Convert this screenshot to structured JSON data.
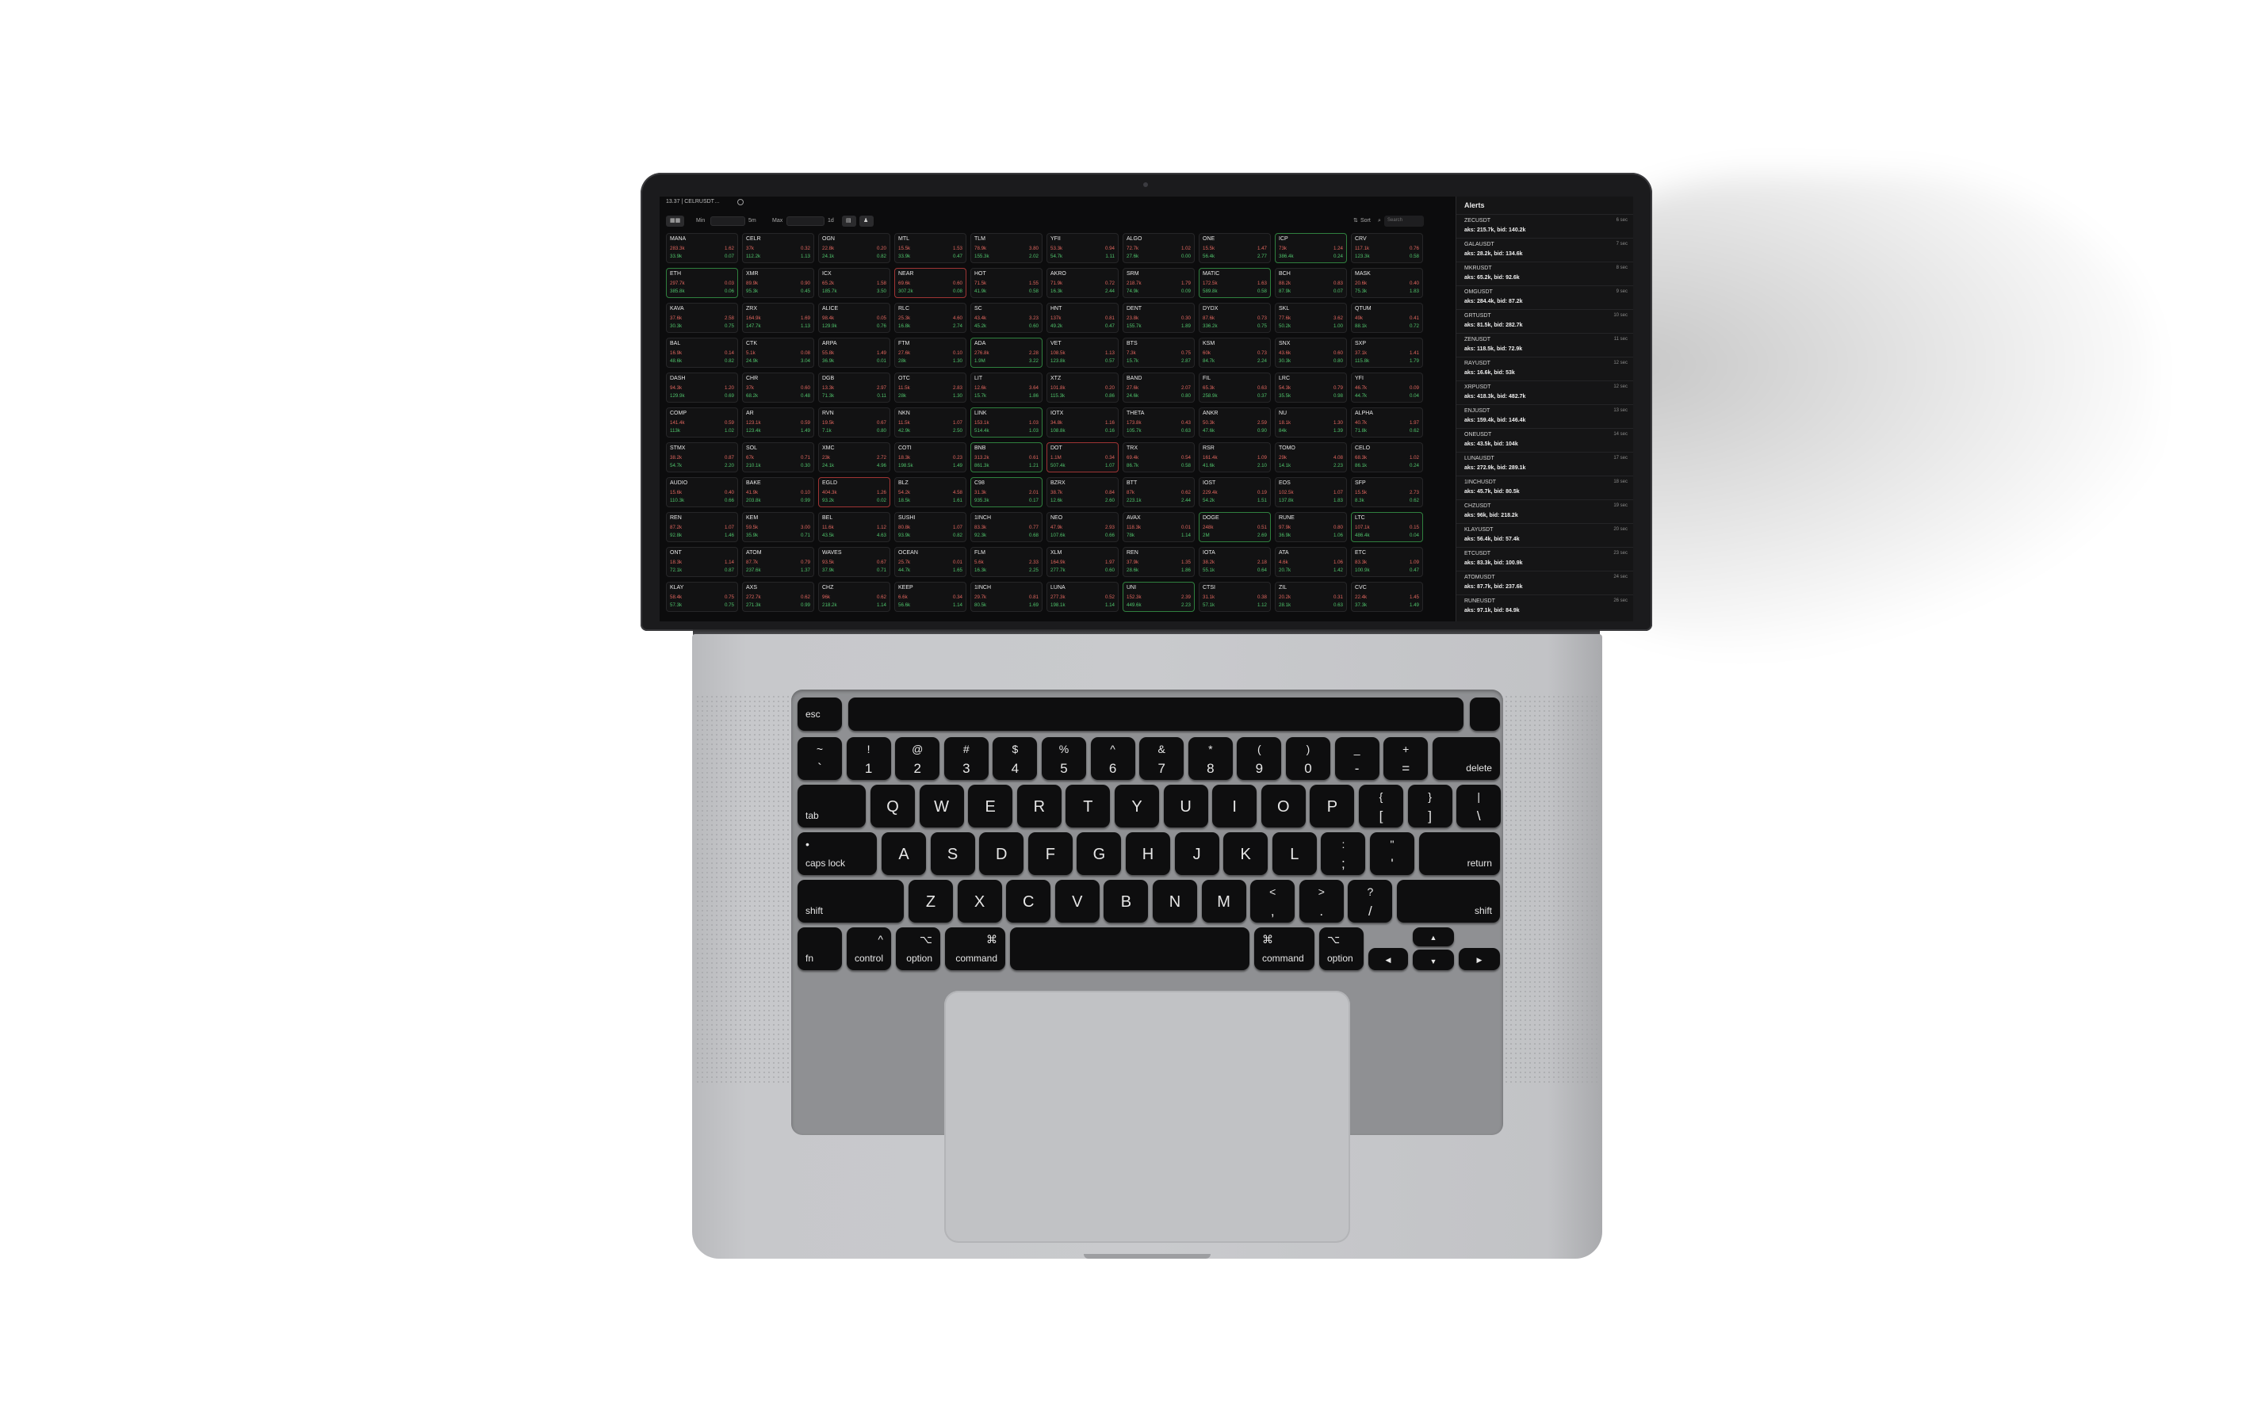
{
  "window": {
    "title": "13.37 | CELRUSDT…"
  },
  "toolbar": {
    "grid_label": "▦▦",
    "min_label": "Min",
    "min_unit": "5m",
    "max_label": "Max",
    "max_unit": "1d",
    "sort_label": "Sort",
    "search_placeholder": "Search"
  },
  "tiles": [
    [
      "MANA",
      "283.3k",
      "1.62",
      "33.9k",
      "0.07",
      ""
    ],
    [
      "CELR",
      "37k",
      "0.32",
      "112.2k",
      "1.13",
      ""
    ],
    [
      "OGN",
      "22.8k",
      "0.20",
      "24.1k",
      "0.82",
      ""
    ],
    [
      "MTL",
      "15.5k",
      "1.53",
      "33.9k",
      "0.47",
      ""
    ],
    [
      "TLM",
      "78.9k",
      "3.80",
      "155.3k",
      "2.02",
      ""
    ],
    [
      "YFII",
      "53.3k",
      "0.94",
      "54.7k",
      "1.11",
      ""
    ],
    [
      "ALGO",
      "72.7k",
      "1.02",
      "27.6k",
      "0.00",
      ""
    ],
    [
      "ONE",
      "15.5k",
      "1.47",
      "56.4k",
      "2.77",
      ""
    ],
    [
      "ICP",
      "73k",
      "1.24",
      "386.4k",
      "0.24",
      "up"
    ],
    [
      "CRV",
      "117.1k",
      "0.76",
      "123.3k",
      "0.58",
      ""
    ],
    [
      "ETH",
      "297.7k",
      "0.03",
      "385.8k",
      "0.06",
      "up"
    ],
    [
      "XMR",
      "89.9k",
      "0.90",
      "95.3k",
      "0.45",
      ""
    ],
    [
      "ICX",
      "65.2k",
      "1.58",
      "185.7k",
      "3.50",
      ""
    ],
    [
      "NEAR",
      "69.6k",
      "0.60",
      "307.2k",
      "0.08",
      "down"
    ],
    [
      "HOT",
      "71.5k",
      "1.55",
      "41.9k",
      "0.58",
      ""
    ],
    [
      "AKRO",
      "71.9k",
      "0.72",
      "16.3k",
      "2.44",
      ""
    ],
    [
      "SRM",
      "218.7k",
      "1.79",
      "74.9k",
      "0.09",
      ""
    ],
    [
      "MATIC",
      "172.5k",
      "1.63",
      "589.8k",
      "0.58",
      "up"
    ],
    [
      "BCH",
      "88.2k",
      "0.83",
      "87.9k",
      "0.07",
      ""
    ],
    [
      "MASK",
      "20.6k",
      "0.40",
      "75.3k",
      "1.83",
      ""
    ],
    [
      "KAVA",
      "37.6k",
      "2.58",
      "30.3k",
      "0.75",
      ""
    ],
    [
      "ZRX",
      "164.9k",
      "1.69",
      "147.7k",
      "1.13",
      ""
    ],
    [
      "ALICE",
      "98.4k",
      "0.05",
      "129.9k",
      "0.76",
      ""
    ],
    [
      "RLC",
      "25.3k",
      "4.60",
      "16.8k",
      "2.74",
      ""
    ],
    [
      "SC",
      "43.4k",
      "3.23",
      "45.2k",
      "0.60",
      ""
    ],
    [
      "HNT",
      "137k",
      "0.81",
      "49.2k",
      "0.47",
      ""
    ],
    [
      "DENT",
      "23.8k",
      "0.30",
      "155.7k",
      "1.89",
      ""
    ],
    [
      "DYDX",
      "87.6k",
      "0.73",
      "336.2k",
      "0.75",
      ""
    ],
    [
      "SKL",
      "77.6k",
      "3.62",
      "50.2k",
      "1.00",
      ""
    ],
    [
      "QTUM",
      "49k",
      "0.41",
      "88.1k",
      "0.72",
      ""
    ],
    [
      "BAL",
      "16.9k",
      "0.14",
      "48.6k",
      "0.82",
      ""
    ],
    [
      "CTK",
      "5.1k",
      "0.08",
      "24.9k",
      "3.04",
      ""
    ],
    [
      "ARPA",
      "55.8k",
      "1.49",
      "36.9k",
      "0.01",
      ""
    ],
    [
      "FTM",
      "27.6k",
      "0.10",
      "28k",
      "1.30",
      ""
    ],
    [
      "ADA",
      "276.8k",
      "2.28",
      "1.9M",
      "3.22",
      "up"
    ],
    [
      "VET",
      "108.5k",
      "1.13",
      "123.8k",
      "0.57",
      ""
    ],
    [
      "BTS",
      "7.3k",
      "0.75",
      "15.7k",
      "2.87",
      ""
    ],
    [
      "KSM",
      "60k",
      "0.73",
      "84.7k",
      "2.24",
      ""
    ],
    [
      "SNX",
      "43.6k",
      "0.60",
      "30.3k",
      "0.80",
      ""
    ],
    [
      "SXP",
      "37.1k",
      "1.41",
      "115.8k",
      "1.79",
      ""
    ],
    [
      "DASH",
      "94.3k",
      "1.20",
      "129.9k",
      "0.69",
      ""
    ],
    [
      "CHR",
      "37k",
      "0.60",
      "68.2k",
      "0.48",
      ""
    ],
    [
      "DGB",
      "13.3k",
      "2.97",
      "71.3k",
      "0.11",
      ""
    ],
    [
      "OTC",
      "11.5k",
      "2.83",
      "28k",
      "1.30",
      ""
    ],
    [
      "LIT",
      "12.6k",
      "3.64",
      "15.7k",
      "1.86",
      ""
    ],
    [
      "XTZ",
      "101.8k",
      "0.20",
      "115.3k",
      "0.86",
      ""
    ],
    [
      "BAND",
      "27.6k",
      "2.07",
      "24.6k",
      "0.80",
      ""
    ],
    [
      "FIL",
      "65.3k",
      "0.63",
      "258.9k",
      "0.37",
      ""
    ],
    [
      "LRC",
      "54.3k",
      "0.79",
      "35.5k",
      "0.98",
      ""
    ],
    [
      "YFI",
      "46.7k",
      "0.09",
      "44.7k",
      "0.04",
      ""
    ],
    [
      "COMP",
      "141.4k",
      "0.59",
      "113k",
      "1.02",
      ""
    ],
    [
      "AR",
      "123.1k",
      "0.59",
      "123.4k",
      "1.49",
      ""
    ],
    [
      "RVN",
      "19.5k",
      "0.67",
      "7.1k",
      "0.80",
      ""
    ],
    [
      "NKN",
      "11.5k",
      "1.07",
      "42.9k",
      "2.50",
      ""
    ],
    [
      "LINK",
      "153.1k",
      "1.03",
      "514.4k",
      "1.03",
      "up"
    ],
    [
      "IOTX",
      "34.8k",
      "1.16",
      "108.8k",
      "0.16",
      ""
    ],
    [
      "THETA",
      "173.8k",
      "0.43",
      "105.7k",
      "0.63",
      ""
    ],
    [
      "ANKR",
      "50.3k",
      "2.59",
      "47.6k",
      "0.90",
      ""
    ],
    [
      "NU",
      "18.1k",
      "1.30",
      "84k",
      "1.39",
      ""
    ],
    [
      "ALPHA",
      "40.7k",
      "1.97",
      "71.8k",
      "0.62",
      ""
    ],
    [
      "STMX",
      "38.2k",
      "0.87",
      "54.7k",
      "2.20",
      ""
    ],
    [
      "SOL",
      "67k",
      "0.71",
      "210.1k",
      "0.30",
      ""
    ],
    [
      "XMC",
      "23k",
      "2.72",
      "24.1k",
      "4.96",
      ""
    ],
    [
      "COTI",
      "18.3k",
      "0.23",
      "198.5k",
      "1.49",
      ""
    ],
    [
      "BNB",
      "313.2k",
      "0.61",
      "861.3k",
      "1.21",
      "up"
    ],
    [
      "DOT",
      "1.1M",
      "0.34",
      "507.4k",
      "1.07",
      "down"
    ],
    [
      "TRX",
      "69.4k",
      "0.54",
      "86.7k",
      "0.58",
      ""
    ],
    [
      "RSR",
      "161.4k",
      "1.09",
      "41.6k",
      "2.10",
      ""
    ],
    [
      "TOMO",
      "29k",
      "4.08",
      "14.1k",
      "2.23",
      ""
    ],
    [
      "CELO",
      "68.3k",
      "1.02",
      "86.1k",
      "0.24",
      ""
    ],
    [
      "AUDIO",
      "15.6k",
      "0.40",
      "110.3k",
      "0.66",
      ""
    ],
    [
      "BAKE",
      "41.9k",
      "0.10",
      "203.8k",
      "0.99",
      ""
    ],
    [
      "EGLD",
      "404.3k",
      "1.26",
      "93.2k",
      "0.02",
      "down"
    ],
    [
      "BLZ",
      "54.2k",
      "4.58",
      "18.5k",
      "1.61",
      ""
    ],
    [
      "C98",
      "31.3k",
      "2.01",
      "935.3k",
      "0.17",
      "up"
    ],
    [
      "BZRX",
      "38.7k",
      "0.84",
      "12.6k",
      "2.60",
      ""
    ],
    [
      "BTT",
      "87k",
      "0.62",
      "223.1k",
      "2.44",
      ""
    ],
    [
      "IOST",
      "229.4k",
      "0.19",
      "54.2k",
      "1.51",
      ""
    ],
    [
      "EOS",
      "102.5k",
      "1.07",
      "137.8k",
      "1.83",
      ""
    ],
    [
      "SFP",
      "15.5k",
      "2.73",
      "8.3k",
      "0.62",
      ""
    ],
    [
      "REN",
      "87.2k",
      "1.07",
      "92.8k",
      "1.46",
      ""
    ],
    [
      "KEM",
      "59.5k",
      "3.00",
      "35.9k",
      "0.71",
      ""
    ],
    [
      "BEL",
      "11.6k",
      "1.12",
      "43.5k",
      "4.63",
      ""
    ],
    [
      "SUSHI",
      "80.8k",
      "1.07",
      "93.9k",
      "0.82",
      ""
    ],
    [
      "1INCH",
      "83.3k",
      "0.77",
      "92.3k",
      "0.68",
      ""
    ],
    [
      "NEO",
      "47.9k",
      "2.93",
      "107.6k",
      "0.66",
      ""
    ],
    [
      "AVAX",
      "118.3k",
      "0.01",
      "78k",
      "1.14",
      ""
    ],
    [
      "DOGE",
      "248k",
      "0.51",
      "2M",
      "2.69",
      "up"
    ],
    [
      "RUNE",
      "97.9k",
      "0.80",
      "36.9k",
      "1.06",
      ""
    ],
    [
      "LTC",
      "107.1k",
      "0.15",
      "486.4k",
      "0.04",
      "up"
    ],
    [
      "ONT",
      "18.3k",
      "1.14",
      "72.1k",
      "0.87",
      ""
    ],
    [
      "ATOM",
      "87.7k",
      "0.79",
      "237.6k",
      "1.37",
      ""
    ],
    [
      "WAVES",
      "93.5k",
      "0.67",
      "37.9k",
      "0.71",
      ""
    ],
    [
      "OCEAN",
      "25.7k",
      "0.01",
      "44.7k",
      "1.65",
      ""
    ],
    [
      "FLM",
      "5.6k",
      "2.33",
      "16.3k",
      "2.25",
      ""
    ],
    [
      "XLM",
      "164.9k",
      "1.97",
      "277.7k",
      "0.60",
      ""
    ],
    [
      "REN",
      "37.9k",
      "1.35",
      "28.6k",
      "1.86",
      ""
    ],
    [
      "IOTA",
      "38.2k",
      "2.18",
      "55.1k",
      "0.64",
      ""
    ],
    [
      "ATA",
      "4.6k",
      "1.06",
      "20.7k",
      "1.42",
      ""
    ],
    [
      "ETC",
      "83.3k",
      "1.09",
      "100.9k",
      "0.47",
      ""
    ],
    [
      "KLAY",
      "58.4k",
      "0.75",
      "57.3k",
      "0.75",
      ""
    ],
    [
      "AXS",
      "272.7k",
      "0.62",
      "271.3k",
      "0.99",
      ""
    ],
    [
      "CHZ",
      "96k",
      "0.62",
      "218.2k",
      "1.14",
      ""
    ],
    [
      "KEEP",
      "6.6k",
      "0.34",
      "56.6k",
      "1.14",
      ""
    ],
    [
      "1INCH",
      "29.7k",
      "0.81",
      "80.5k",
      "1.69",
      ""
    ],
    [
      "LUNA",
      "277.3k",
      "0.52",
      "198.1k",
      "1.14",
      ""
    ],
    [
      "UNI",
      "152.3k",
      "2.39",
      "449.6k",
      "2.23",
      "up"
    ],
    [
      "CTSI",
      "31.1k",
      "0.38",
      "57.1k",
      "1.12",
      ""
    ],
    [
      "ZIL",
      "20.2k",
      "0.31",
      "28.1k",
      "0.63",
      ""
    ],
    [
      "CVC",
      "22.4k",
      "1.45",
      "37.3k",
      "1.49",
      ""
    ]
  ],
  "alerts": {
    "title": "Alerts",
    "items": [
      {
        "pair": "ZECUSDT",
        "time": "6 sec",
        "detail": "aks: 215.7k, bid: 140.2k"
      },
      {
        "pair": "GALAUSDT",
        "time": "7 sec",
        "detail": "aks: 28.2k, bid: 134.6k"
      },
      {
        "pair": "MKRUSDT",
        "time": "8 sec",
        "detail": "aks: 65.2k, bid: 92.6k"
      },
      {
        "pair": "OMGUSDT",
        "time": "9 sec",
        "detail": "aks: 284.4k, bid: 87.2k"
      },
      {
        "pair": "GRTUSDT",
        "time": "10 sec",
        "detail": "aks: 81.5k, bid: 282.7k"
      },
      {
        "pair": "ZENUSDT",
        "time": "11 sec",
        "detail": "aks: 118.5k, bid: 72.9k"
      },
      {
        "pair": "RAYUSDT",
        "time": "12 sec",
        "detail": "aks: 16.6k, bid: 53k"
      },
      {
        "pair": "XRPUSDT",
        "time": "12 sec",
        "detail": "aks: 418.3k, bid: 482.7k"
      },
      {
        "pair": "ENJUSDT",
        "time": "13 sec",
        "detail": "aks: 159.4k, bid: 146.4k"
      },
      {
        "pair": "ONEUSDT",
        "time": "14 sec",
        "detail": "aks: 43.5k, bid: 104k"
      },
      {
        "pair": "LUNAUSDT",
        "time": "17 sec",
        "detail": "aks: 272.9k, bid: 289.1k"
      },
      {
        "pair": "1INCHUSDT",
        "time": "18 sec",
        "detail": "aks: 45.7k, bid: 80.5k"
      },
      {
        "pair": "CHZUSDT",
        "time": "19 sec",
        "detail": "aks: 96k, bid: 218.2k"
      },
      {
        "pair": "KLAYUSDT",
        "time": "20 sec",
        "detail": "aks: 56.4k, bid: 57.4k"
      },
      {
        "pair": "ETCUSDT",
        "time": "23 sec",
        "detail": "aks: 83.3k, bid: 100.9k"
      },
      {
        "pair": "ATOMUSDT",
        "time": "24 sec",
        "detail": "aks: 87.7k, bid: 237.6k"
      },
      {
        "pair": "RUNEUSDT",
        "time": "26 sec",
        "detail": "aks: 97.1k, bid: 84.9k"
      }
    ]
  },
  "keyboard": {
    "esc": "esc",
    "delete": "delete",
    "tab": "tab",
    "caps": "caps lock",
    "return": "return",
    "shift": "shift",
    "fn": "fn",
    "control": "control",
    "option": "option",
    "command": "command",
    "num_row": [
      [
        "~",
        "`"
      ],
      [
        "!",
        "1"
      ],
      [
        "@",
        "2"
      ],
      [
        "#",
        "3"
      ],
      [
        "$",
        "4"
      ],
      [
        "%",
        "5"
      ],
      [
        "^",
        "6"
      ],
      [
        "&",
        "7"
      ],
      [
        "*",
        "8"
      ],
      [
        "(",
        "9"
      ],
      [
        ")",
        "0"
      ],
      [
        "_",
        "-"
      ],
      [
        "+",
        "="
      ]
    ],
    "q_row": [
      "Q",
      "W",
      "E",
      "R",
      "T",
      "Y",
      "U",
      "I",
      "O",
      "P"
    ],
    "q_extra": [
      [
        "{",
        "["
      ],
      [
        "}",
        "]"
      ],
      [
        "|",
        "\\"
      ]
    ],
    "a_row": [
      "A",
      "S",
      "D",
      "F",
      "G",
      "H",
      "J",
      "K",
      "L"
    ],
    "a_extra": [
      [
        ":",
        ";"
      ],
      [
        "\"",
        "'"
      ]
    ],
    "z_row": [
      "Z",
      "X",
      "C",
      "V",
      "B",
      "N",
      "M"
    ],
    "z_extra": [
      [
        "<",
        ","
      ],
      [
        ">",
        "."
      ],
      [
        "?",
        "/"
      ]
    ],
    "ctrl_sym": "^",
    "opt_sym": "⌥",
    "cmd_sym": "⌘",
    "arrows": {
      "left": "◀",
      "up": "▲",
      "down": "▼",
      "right": "▶"
    }
  }
}
